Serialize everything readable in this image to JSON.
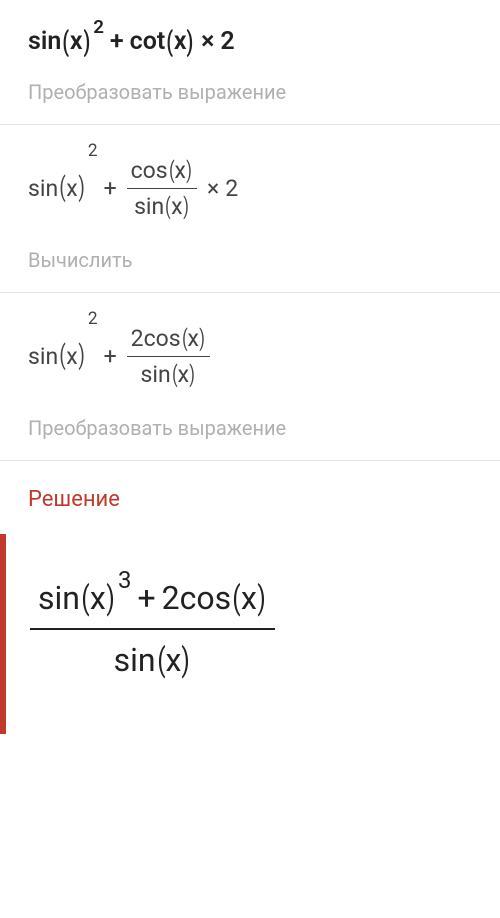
{
  "steps": [
    {
      "hint": "Преобразовать выражение"
    },
    {
      "hint": "Вычислить"
    },
    {
      "hint": "Преобразовать выражение"
    }
  ],
  "fn": {
    "sin": "sin",
    "cos": "cos",
    "cot": "cot"
  },
  "var": "x",
  "exp2": "2",
  "exp3": "3",
  "two": "2",
  "plus": "+",
  "mult": "×",
  "lp": "(",
  "rp": ")",
  "solution_label": "Решение"
}
